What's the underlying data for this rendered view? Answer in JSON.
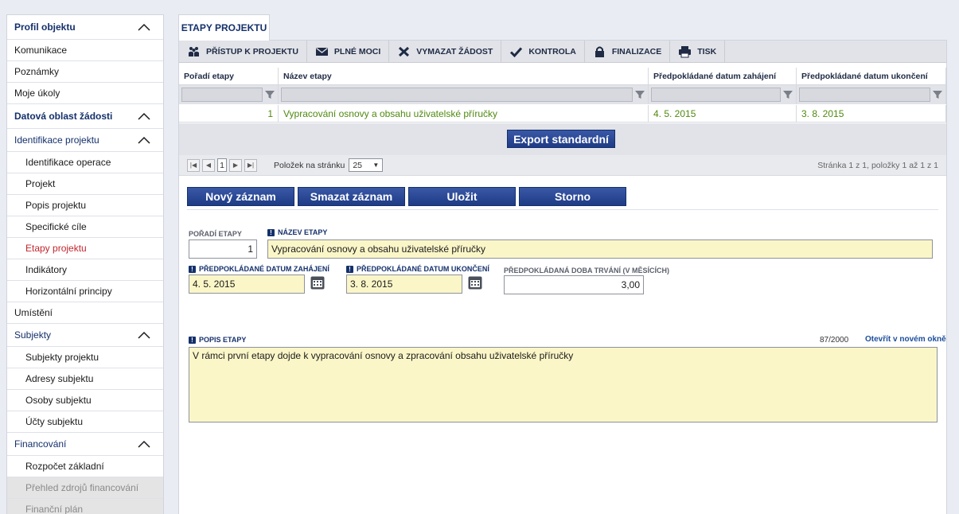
{
  "sidebar": {
    "items": [
      {
        "label": "Profil objektu",
        "kind": "hdr",
        "chev": true
      },
      {
        "label": "Komunikace",
        "kind": "plain"
      },
      {
        "label": "Poznámky",
        "kind": "plain"
      },
      {
        "label": "Moje úkoly",
        "kind": "plain"
      },
      {
        "label": "Datová oblast žádosti",
        "kind": "hdr",
        "chev": true
      },
      {
        "label": "Identifikace projektu",
        "kind": "sec",
        "chev": true
      },
      {
        "label": "Identifikace operace",
        "kind": "sub"
      },
      {
        "label": "Projekt",
        "kind": "sub"
      },
      {
        "label": "Popis projektu",
        "kind": "sub"
      },
      {
        "label": "Specifické cíle",
        "kind": "sub"
      },
      {
        "label": "Etapy projektu",
        "kind": "sub",
        "active": true
      },
      {
        "label": "Indikátory",
        "kind": "sub"
      },
      {
        "label": "Horizontální principy",
        "kind": "sub"
      },
      {
        "label": "Umístění",
        "kind": "plain"
      },
      {
        "label": "Subjekty",
        "kind": "sec",
        "chev": true
      },
      {
        "label": "Subjekty projektu",
        "kind": "sub"
      },
      {
        "label": "Adresy subjektu",
        "kind": "sub"
      },
      {
        "label": "Osoby subjektu",
        "kind": "sub"
      },
      {
        "label": "Účty subjektu",
        "kind": "sub"
      },
      {
        "label": "Financování",
        "kind": "sec",
        "chev": true
      },
      {
        "label": "Rozpočet základní",
        "kind": "sub"
      },
      {
        "label": "Přehled zdrojů financování",
        "kind": "sub",
        "disabled": true
      },
      {
        "label": "Finanční plán",
        "kind": "sub",
        "disabled": true
      }
    ]
  },
  "tab": {
    "label": "ETAPY PROJEKTU"
  },
  "toolbar": {
    "buttons": [
      {
        "label": "PŘÍSTUP K PROJEKTU",
        "icon": "people-icon"
      },
      {
        "label": "PLNÉ MOCI",
        "icon": "envelope-icon"
      },
      {
        "label": "VYMAZAT ŽÁDOST",
        "icon": "x-icon"
      },
      {
        "label": "KONTROLA",
        "icon": "check-icon"
      },
      {
        "label": "FINALIZACE",
        "icon": "lock-icon"
      },
      {
        "label": "TISK",
        "icon": "printer-icon"
      }
    ]
  },
  "grid": {
    "columns": [
      "Pořadí etapy",
      "Název etapy",
      "Předpokládané datum zahájení",
      "Předpokládané datum ukončení"
    ],
    "rows": [
      {
        "poradi": "1",
        "nazev": "Vypracování osnovy a obsahu uživatelské příručky",
        "zahajeni": "4. 5. 2015",
        "ukonceni": "3. 8. 2015"
      }
    ],
    "export_label": "Export standardní"
  },
  "pager": {
    "current_page": "1",
    "per_page_label": "Položek na stránku",
    "per_page_value": "25",
    "info": "Stránka 1 z 1, položky 1 až 1 z 1"
  },
  "form": {
    "buttons": {
      "new": "Nový záznam",
      "delete": "Smazat záznam",
      "save": "Uložit",
      "cancel": "Storno"
    },
    "poradi_label": "POŘADÍ ETAPY",
    "poradi_value": "1",
    "nazev_label": "NÁZEV ETAPY",
    "nazev_value": "Vypracování osnovy  a obsahu uživatelské příručky",
    "zahajeni_label": "PŘEDPOKLÁDANÉ DATUM ZAHÁJENÍ",
    "zahajeni_value": "4. 5. 2015",
    "ukonceni_label": "PŘEDPOKLÁDANÉ DATUM UKONČENÍ",
    "ukonceni_value": "3. 8. 2015",
    "doba_label": "PŘEDPOKLÁDANÁ DOBA TRVÁNÍ (V MĚSÍCÍCH)",
    "doba_value": "3,00",
    "popis_label": "POPIS ETAPY",
    "popis_count": "87/2000",
    "popis_link": "Otevřít v novém okně",
    "popis_value": "V rámci první etapy dojde k vypracování osnovy a zpracování obsahu uživatelské příručky"
  }
}
